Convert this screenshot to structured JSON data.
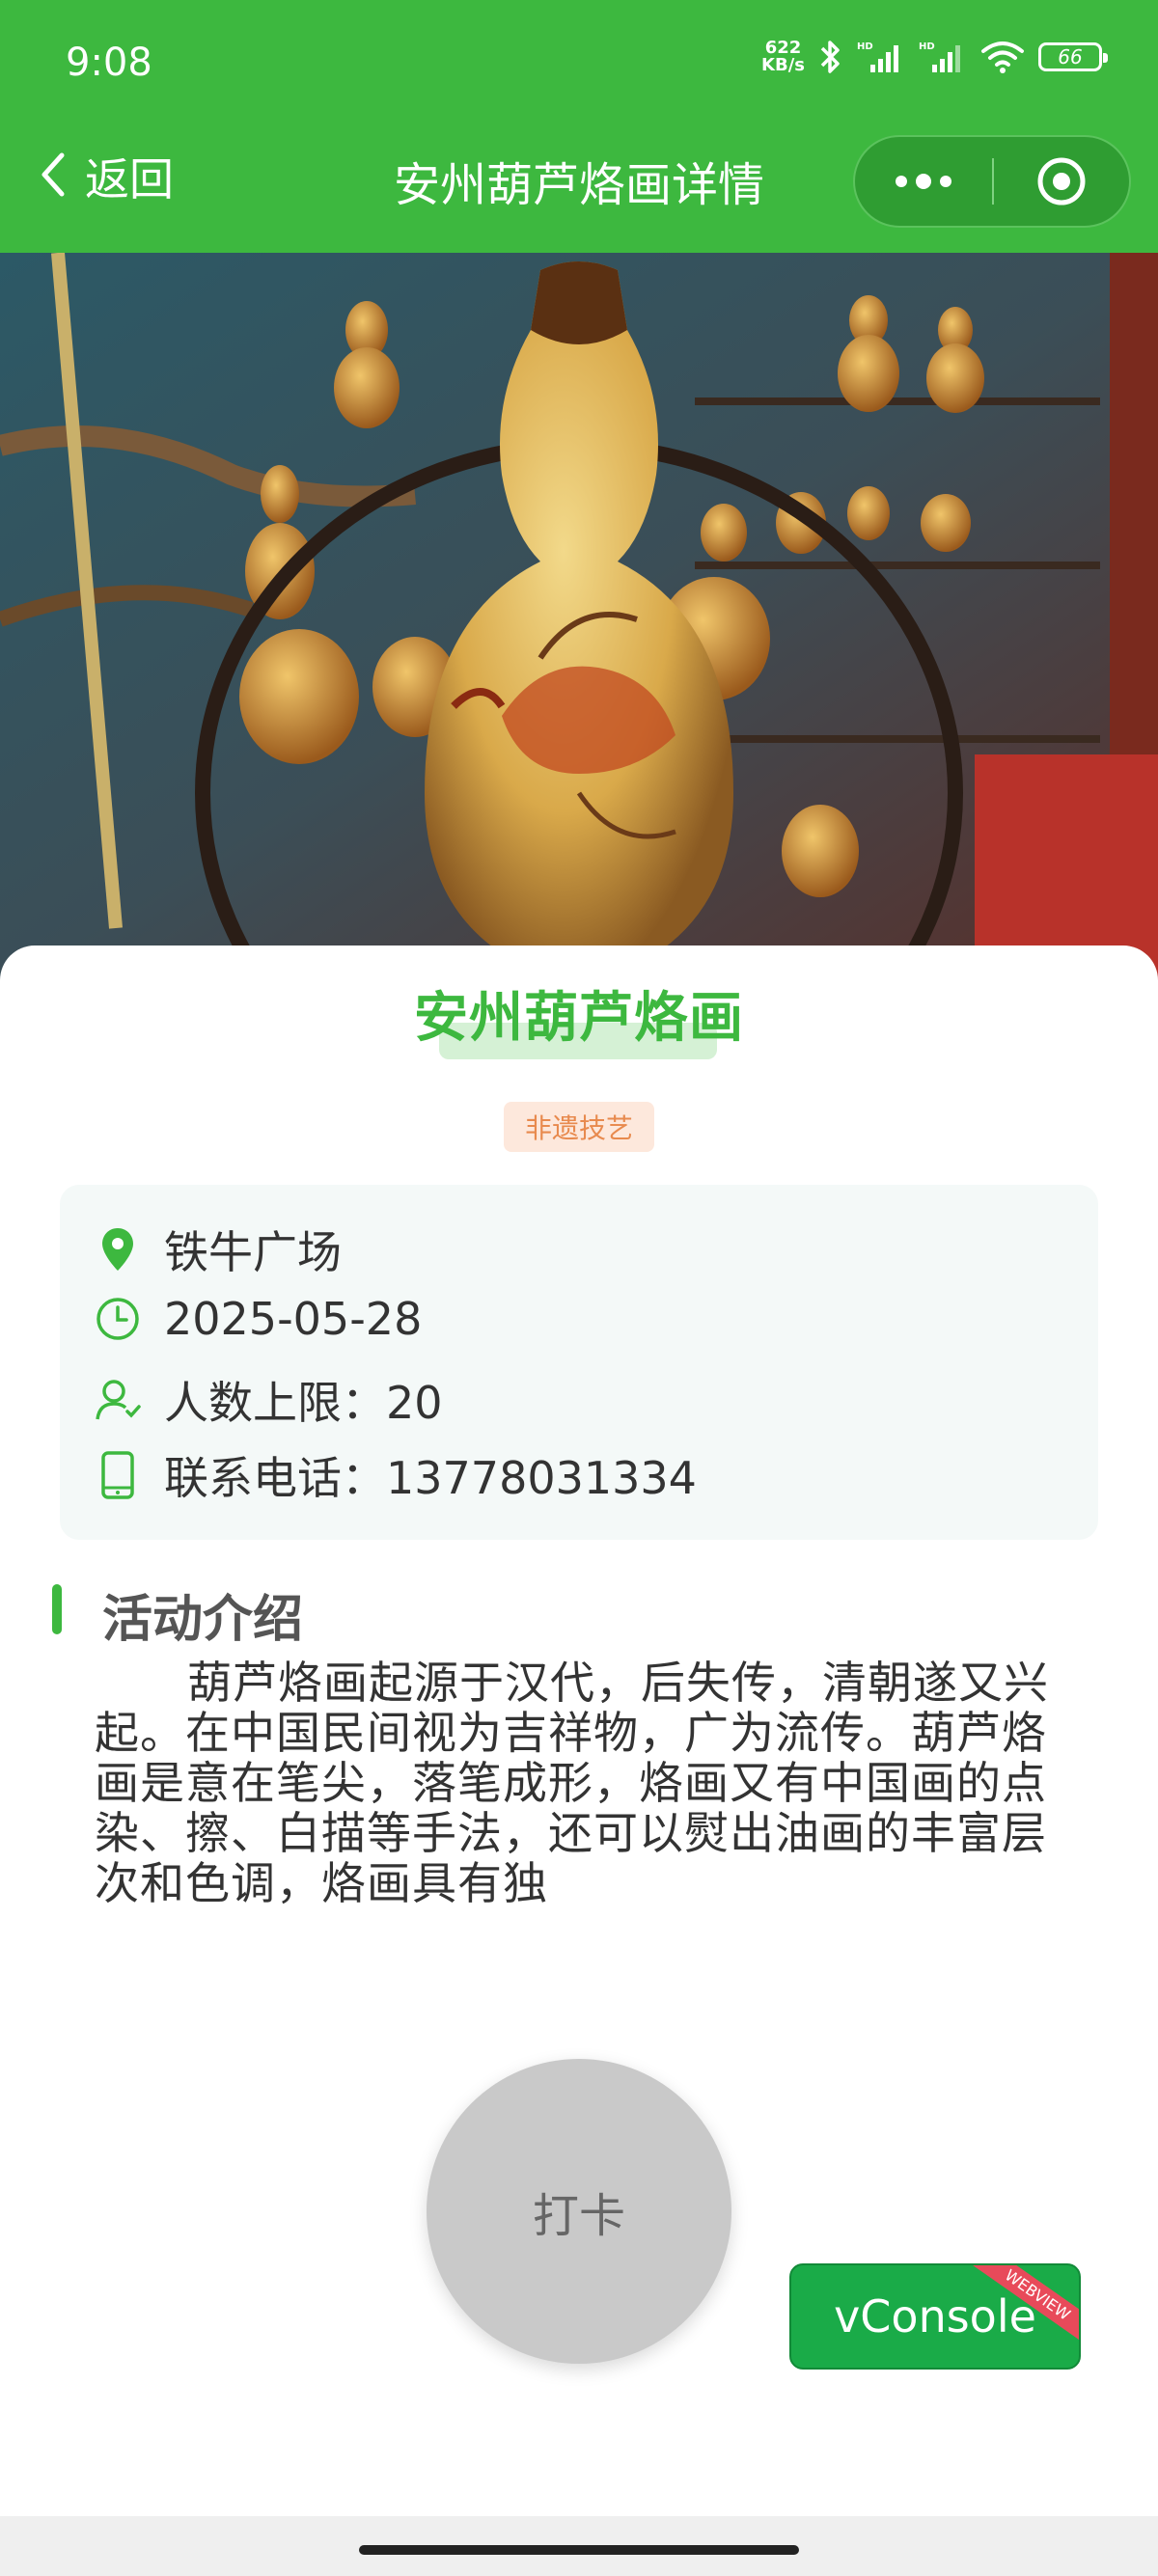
{
  "status_bar": {
    "time": "9:08",
    "net_speed_value": "622",
    "net_speed_unit": "KB/s",
    "battery": "66"
  },
  "nav": {
    "back_label": "返回",
    "title": "安州葫芦烙画详情"
  },
  "activity": {
    "title": "安州葫芦烙画",
    "tag": "非遗技艺",
    "location": "铁牛广场",
    "date": "2025-05-28",
    "capacity": "人数上限：20",
    "phone": "联系电话：13778031334"
  },
  "intro": {
    "heading": "活动介绍",
    "text": "葫芦烙画起源于汉代，后失传，清朝遂又兴起。在中国民间视为吉祥物，广为流传。葫芦烙画是意在笔尖，落笔成形，烙画又有中国画的点染、擦、白描等手法，还可以熨出油画的丰富层次和色调，烙画具有独"
  },
  "buttons": {
    "checkin": "打卡",
    "vconsole": "vConsole",
    "webview_badge": "WEBVIEW"
  },
  "colors": {
    "brand_green": "#3db83f",
    "tag_bg": "#fde8dc",
    "tag_text": "#e88a4e",
    "vconsole_green": "#1aab48"
  }
}
